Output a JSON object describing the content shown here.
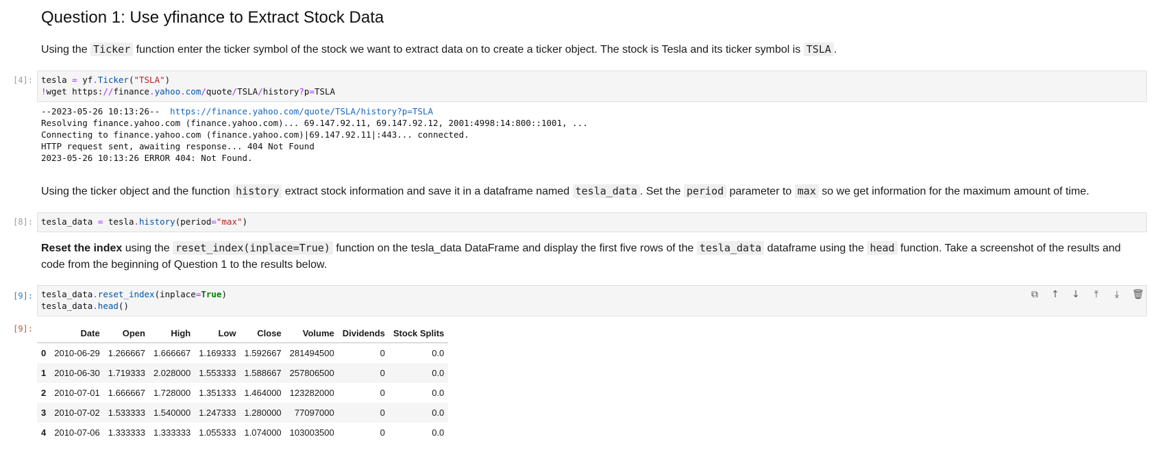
{
  "q1": {
    "heading": "Question 1: Use yfinance to Extract Stock Data",
    "p1_a": "Using the ",
    "p1_code1": "Ticker",
    "p1_b": " function enter the ticker symbol of the stock we want to extract data on to create a ticker object. The stock is Tesla and its ticker symbol is ",
    "p1_code2": "TSLA",
    "p1_c": "."
  },
  "cell4": {
    "prompt": "[4]:",
    "output": [
      {
        "prefix": "--2023-05-26 10:13:26--  ",
        "link": "https://finance.yahoo.com/quote/TSLA/history?p=TSLA"
      },
      "Resolving finance.yahoo.com (finance.yahoo.com)... 69.147.92.11, 69.147.92.12, 2001:4998:14:800::1001, ...",
      "Connecting to finance.yahoo.com (finance.yahoo.com)|69.147.92.11|:443... connected.",
      "HTTP request sent, awaiting response... 404 Not Found",
      "2023-05-26 10:13:26 ERROR 404: Not Found."
    ]
  },
  "p2": {
    "a": "Using the ticker object and the function ",
    "code1": "history",
    "b": " extract stock information and save it in a dataframe named ",
    "code2": "tesla_data",
    "c": ". Set the ",
    "code3": "period",
    "d": " parameter to ",
    "code4": "max",
    "e": " so we get information for the maximum amount of time."
  },
  "cell8": {
    "prompt": "[8]:"
  },
  "p3": {
    "bold": "Reset the index",
    "a": " using the ",
    "code1": "reset_index(inplace=True)",
    "b": " function on the tesla_data DataFrame and display the first five rows of the ",
    "code2": "tesla_data",
    "c": " dataframe using the ",
    "code3": "head",
    "d": " function. Take a screenshot of the results and code from the beginning of Question 1 to the results below."
  },
  "cell9": {
    "prompt": "[9]:",
    "out_prompt": "[9]:"
  },
  "toolbar_icons": [
    "copy-icon",
    "arrow-up-icon",
    "arrow-down-icon",
    "insert-above-icon",
    "insert-below-icon",
    "trash-icon"
  ],
  "table": {
    "columns": [
      "",
      "Date",
      "Open",
      "High",
      "Low",
      "Close",
      "Volume",
      "Dividends",
      "Stock Splits"
    ],
    "rows": [
      [
        "0",
        "2010-06-29",
        "1.266667",
        "1.666667",
        "1.169333",
        "1.592667",
        "281494500",
        "0",
        "0.0"
      ],
      [
        "1",
        "2010-06-30",
        "1.719333",
        "2.028000",
        "1.553333",
        "1.588667",
        "257806500",
        "0",
        "0.0"
      ],
      [
        "2",
        "2010-07-01",
        "1.666667",
        "1.728000",
        "1.351333",
        "1.464000",
        "123282000",
        "0",
        "0.0"
      ],
      [
        "3",
        "2010-07-02",
        "1.533333",
        "1.540000",
        "1.247333",
        "1.280000",
        "77097000",
        "0",
        "0.0"
      ],
      [
        "4",
        "2010-07-06",
        "1.333333",
        "1.333333",
        "1.055333",
        "1.074000",
        "103003500",
        "0",
        "0.0"
      ]
    ]
  },
  "colors": {
    "prompt_active": "#307fc1",
    "prompt_out": "#bf5b3d",
    "link": "#1565c0"
  }
}
